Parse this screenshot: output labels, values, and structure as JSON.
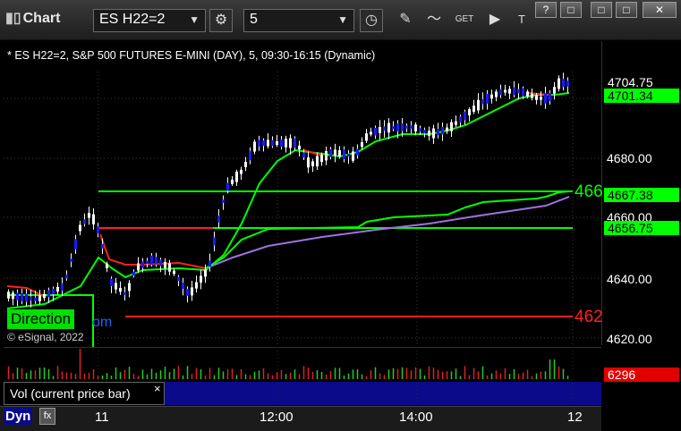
{
  "titlebar": {
    "app_title": "Chart",
    "symbol": "ES H22=2",
    "interval": "5",
    "window_buttons": [
      "?",
      "□",
      "□",
      "✕"
    ]
  },
  "chart": {
    "info": "* ES H22=2, S&P 500 FUTURES E-MINI (DAY), 5, 09:30-16:15 (Dynamic)",
    "direction_label": "Direction",
    "com_label": "om",
    "copyright": "© eSignal, 2022",
    "right_green_label": "466",
    "right_red_label": "462"
  },
  "price_axis": {
    "labels": [
      "4680.00",
      "4660.00",
      "4640.00",
      "4620.00"
    ],
    "tag_current": "4704.75",
    "tag_ma": "4701.34",
    "tag_line1": "4667.38",
    "tag_line2": "4656.75"
  },
  "volume": {
    "legend": "Vol (current price bar)",
    "close": "×",
    "tag": "6296"
  },
  "time_axis": {
    "labels": [
      "11",
      "12:00",
      "14:00",
      "12"
    ],
    "dyn": "Dyn"
  },
  "colors": {
    "green": "#00ff00",
    "red": "#ff2020",
    "purple": "#a070e0",
    "blue": "#1a1aff"
  }
}
